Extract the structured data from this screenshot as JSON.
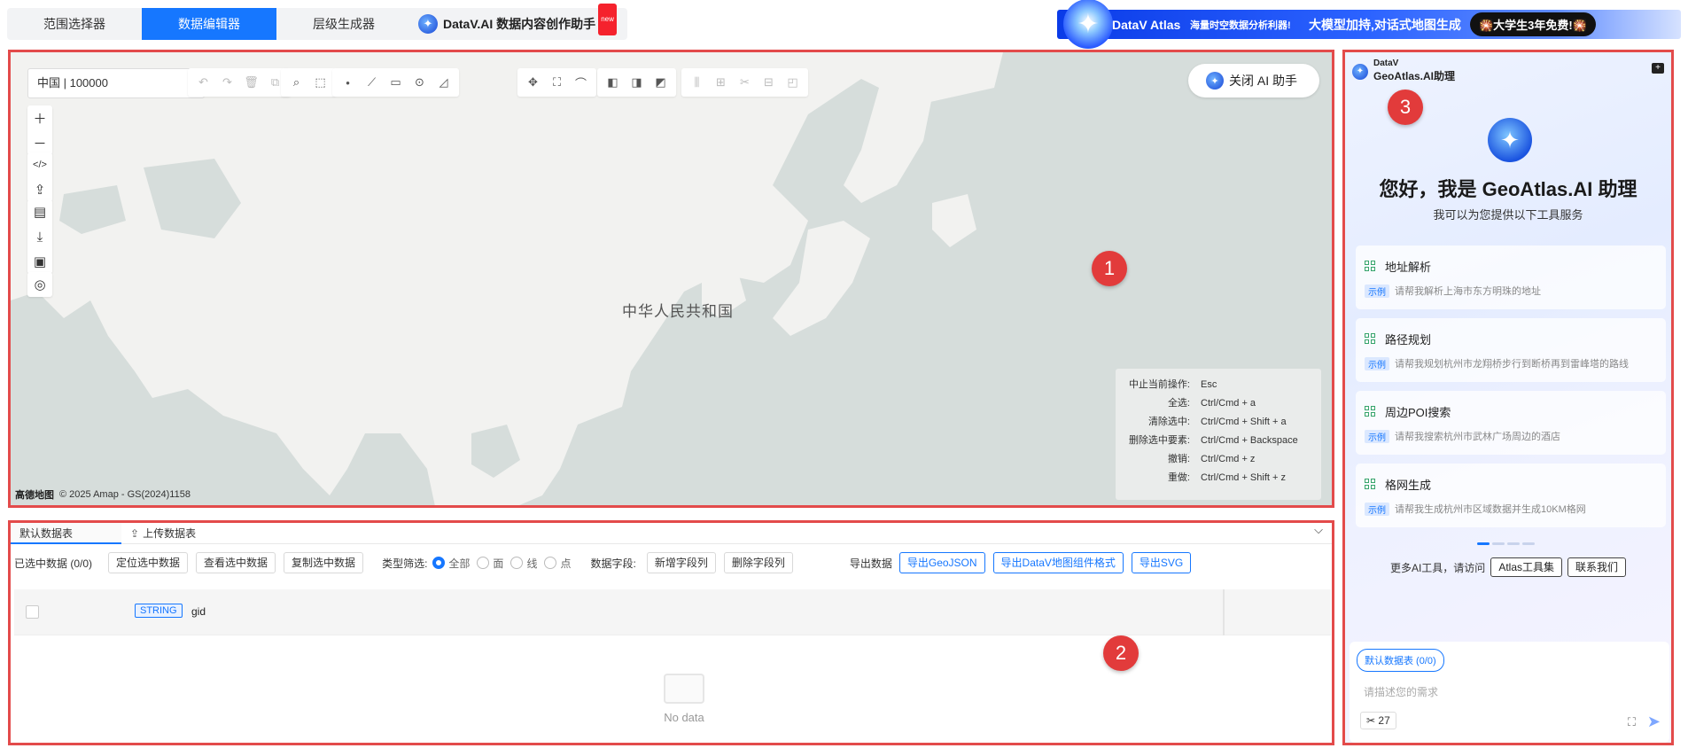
{
  "topbar": {
    "tabs": [
      {
        "label": "范围选择器"
      },
      {
        "label": "数据编辑器"
      },
      {
        "label": "层级生成器"
      }
    ],
    "ai_tab": {
      "label": "DataV.AI 数据内容创作助手",
      "badge": "new"
    },
    "banner": {
      "brand": "DataV Atlas",
      "tagline": "海量时空数据分析利器!",
      "slogan": "大模型加持,对话式地图生成",
      "promo": "🎇大学生3年免费!🎇"
    }
  },
  "map": {
    "region_select": "中国 | 100000",
    "ai_toggle": "关闭 AI 助手",
    "country_label": "中华人民共和国",
    "attribution": {
      "logo": "高德地图",
      "text": "© 2025 Amap - GS(2024)1158"
    },
    "shortcuts": [
      {
        "action": "中止当前操作:",
        "key": "Esc"
      },
      {
        "action": "全选:",
        "key": "Ctrl/Cmd + a"
      },
      {
        "action": "清除选中:",
        "key": "Ctrl/Cmd + Shift + a"
      },
      {
        "action": "删除选中要素:",
        "key": "Ctrl/Cmd + Backspace"
      },
      {
        "action": "撤销:",
        "key": "Ctrl/Cmd + z"
      },
      {
        "action": "重做:",
        "key": "Ctrl/Cmd + Shift + z"
      }
    ]
  },
  "table": {
    "tabs": [
      {
        "label": "默认数据表"
      },
      {
        "label": "上传数据表"
      }
    ],
    "selected_label": "已选中数据 (0/0)",
    "buttons": {
      "locate": "定位选中数据",
      "view": "查看选中数据",
      "copy": "复制选中数据",
      "add_field": "新增字段列",
      "del_field": "删除字段列",
      "export_geojson": "导出GeoJSON",
      "export_datav": "导出DataV地图组件格式",
      "export_svg": "导出SVG"
    },
    "type_filter_label": "类型筛选:",
    "type_filter_options": [
      "全部",
      "面",
      "线",
      "点"
    ],
    "field_label": "数据字段:",
    "export_label": "导出数据",
    "column": {
      "type": "STRING",
      "name": "gid"
    },
    "empty_text": "No data"
  },
  "ai_panel": {
    "brand_small": "DataV",
    "brand": "GeoAtlas.AI助理",
    "greeting": "您好，我是 GeoAtlas.AI 助理",
    "subtitle": "我可以为您提供以下工具服务",
    "example_tag": "示例",
    "cards": [
      {
        "title": "地址解析",
        "example": "请帮我解析上海市东方明珠的地址"
      },
      {
        "title": "路径规划",
        "example": "请帮我规划杭州市龙翔桥步行到断桥再到雷峰塔的路线"
      },
      {
        "title": "周边POI搜索",
        "example": "请帮我搜索杭州市武林广场周边的酒店"
      },
      {
        "title": "格网生成",
        "example": "请帮我生成杭州市区域数据并生成10KM格网"
      }
    ],
    "more_text": "更多AI工具，请访问",
    "atlas_button": "Atlas工具集",
    "contact_button": "联系我们",
    "dataset_tag": "默认数据表 (0/0)",
    "input_placeholder": "请描述您的需求",
    "tool_count": "27"
  },
  "markers": [
    "1",
    "2",
    "3"
  ],
  "colors": {
    "accent": "#1677ff",
    "highlight_border": "#e34b4b",
    "marker": "#e23b3b",
    "map_water": "#d6dddb",
    "map_land": "#f2f2f0"
  }
}
